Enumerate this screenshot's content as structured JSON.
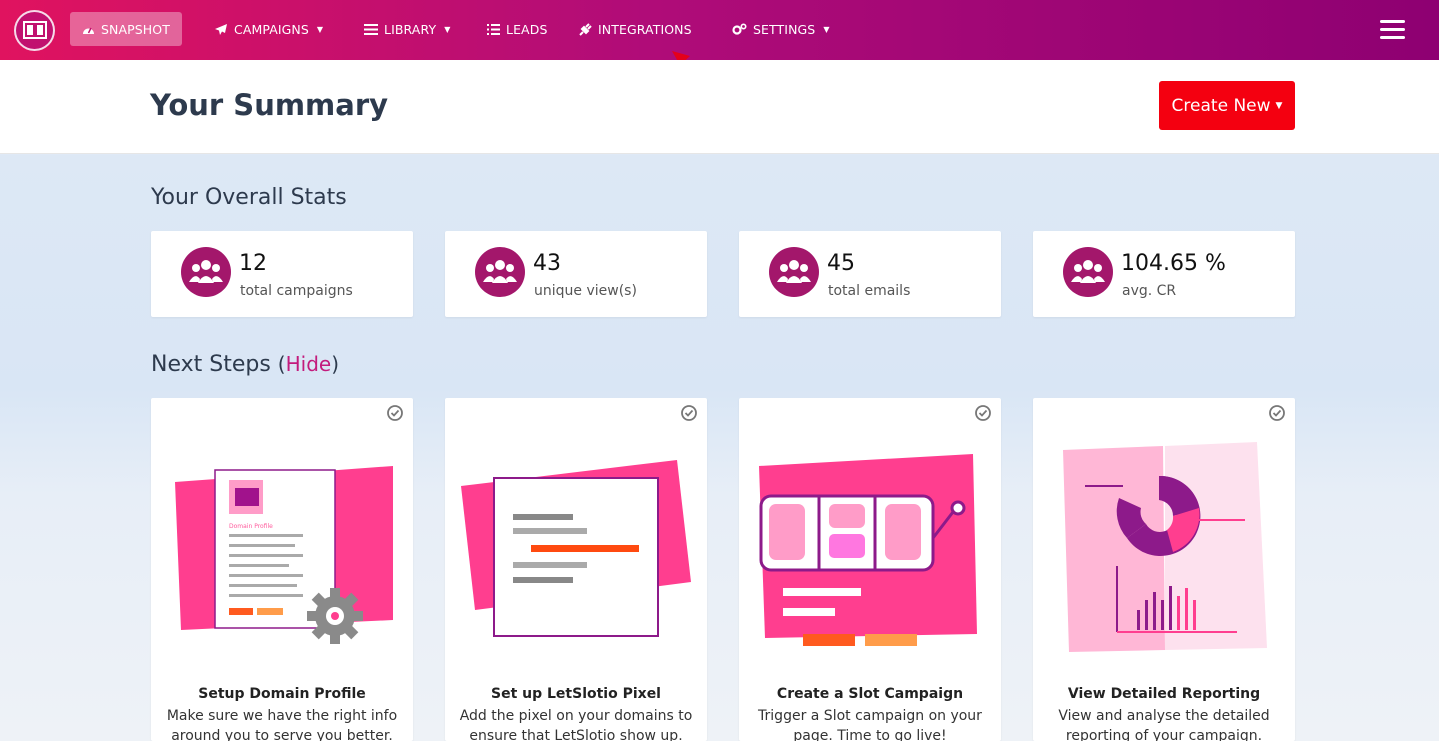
{
  "nav": {
    "items": [
      {
        "label": "SNAPSHOT",
        "icon": "dashboard-icon",
        "active": true
      },
      {
        "label": "CAMPAIGNS",
        "icon": "paper-plane-icon",
        "dropdown": true
      },
      {
        "label": "LIBRARY",
        "icon": "library-icon",
        "dropdown": true
      },
      {
        "label": "LEADS",
        "icon": "list-icon"
      },
      {
        "label": "INTEGRATIONS",
        "icon": "plug-icon"
      },
      {
        "label": "SETTINGS",
        "icon": "cogs-icon",
        "dropdown": true
      }
    ]
  },
  "header": {
    "title": "Your Summary",
    "create_label": "Create New"
  },
  "stats": {
    "title": "Your Overall Stats",
    "cards": [
      {
        "value": "12",
        "label": "total campaigns"
      },
      {
        "value": "43",
        "label": "unique view(s)"
      },
      {
        "value": "45",
        "label": "total emails"
      },
      {
        "value": "104.65 %",
        "label": "avg. CR"
      }
    ]
  },
  "next_steps": {
    "title": "Next Steps",
    "hide_label": "Hide",
    "cards": [
      {
        "title": "Setup Domain Profile",
        "desc": "Make sure we have the right info around you to serve you better.",
        "doc_label": "Domain Profile"
      },
      {
        "title": "Set up LetSlotio Pixel",
        "desc": "Add the pixel on your domains to ensure that LetSlotio show up."
      },
      {
        "title": "Create a Slot Campaign",
        "desc": "Trigger a Slot campaign on your page. Time to go live!"
      },
      {
        "title": "View Detailed Reporting",
        "desc": "View and analyse the detailed reporting of your campaign."
      }
    ]
  },
  "colors": {
    "brand": "#c1116f",
    "accent": "#f40010",
    "pink": "#ff3e8f"
  }
}
